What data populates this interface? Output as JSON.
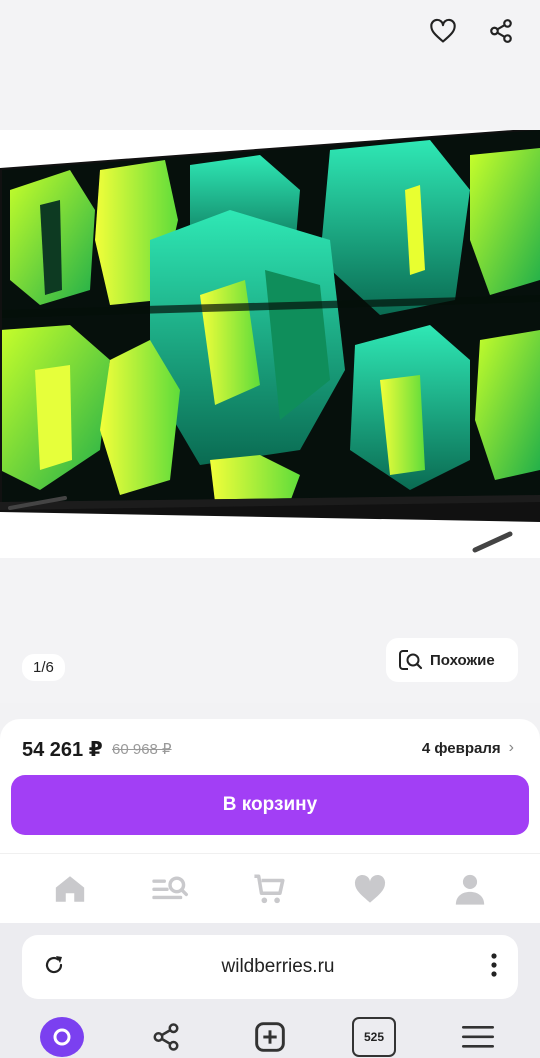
{
  "gallery": {
    "counter": "1/6",
    "similar_label": "Похожие"
  },
  "product": {
    "price": "54 261 ₽",
    "old_price": "60 968 ₽",
    "delivery": "4 февраля",
    "cart_label": "В корзину"
  },
  "app_nav": {
    "items": [
      "home-icon",
      "catalog-search-icon",
      "cart-icon",
      "favorites-icon",
      "profile-icon"
    ]
  },
  "browser": {
    "url": "wildberries.ru",
    "tabs_count": "525"
  },
  "colors": {
    "accent": "#a23ff5",
    "alice": "#7b40f0"
  }
}
